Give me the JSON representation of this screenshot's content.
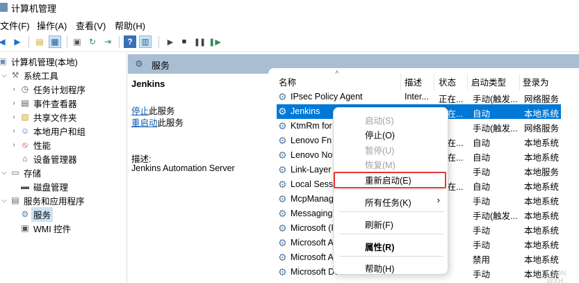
{
  "window": {
    "title": "计算机管理"
  },
  "menu": [
    "文件(F)",
    "操作(A)",
    "查看(V)",
    "帮助(H)"
  ],
  "tree": {
    "root": "计算机管理(本地)",
    "system_tools": "系统工具",
    "task_scheduler": "任务计划程序",
    "event_viewer": "事件查看器",
    "shared_folders": "共享文件夹",
    "local_users": "本地用户和组",
    "performance": "性能",
    "device_manager": "设备管理器",
    "storage": "存储",
    "disk_management": "磁盘管理",
    "services_apps": "服务和应用程序",
    "services": "服务",
    "wmi": "WMI 控件"
  },
  "pane": {
    "title": "服务"
  },
  "description": {
    "service_name": "Jenkins",
    "stop_link": "停止",
    "stop_suffix": "此服务",
    "restart_link": "重启动",
    "restart_suffix": "此服务",
    "desc_label": "描述:",
    "desc_text": "Jenkins Automation Server"
  },
  "columns": {
    "name": "名称",
    "desc": "描述",
    "status": "状态",
    "startup": "启动类型",
    "logon": "登录为"
  },
  "rows": [
    {
      "name": "IPsec Policy Agent",
      "desc": "Inter...",
      "status": "正在...",
      "startup": "手动(触发...",
      "logon": "网络服务"
    },
    {
      "name": "Jenkins",
      "desc": "",
      "status": "正在...",
      "startup": "自动",
      "logon": "本地系统",
      "selected": true
    },
    {
      "name": "KtmRm for",
      "desc": "",
      "status": "",
      "startup": "手动(触发...",
      "logon": "网络服务"
    },
    {
      "name": "Lenovo Fn a",
      "desc": "",
      "status": "正在...",
      "startup": "自动",
      "logon": "本地系统"
    },
    {
      "name": "Lenovo Not",
      "desc": "",
      "status": "正在...",
      "startup": "自动",
      "logon": "本地系统"
    },
    {
      "name": "Link-Layer T",
      "desc": "",
      "status": "",
      "startup": "手动",
      "logon": "本地服务"
    },
    {
      "name": "Local Sessio",
      "desc": "",
      "status": "正在...",
      "startup": "自动",
      "logon": "本地系统"
    },
    {
      "name": "McpManage",
      "desc": "",
      "status": "",
      "startup": "手动",
      "logon": "本地系统"
    },
    {
      "name": "MessagingS",
      "desc": "",
      "status": "",
      "startup": "手动(触发...",
      "logon": "本地系统"
    },
    {
      "name": "Microsoft (F",
      "desc": "",
      "status": "",
      "startup": "手动",
      "logon": "本地系统"
    },
    {
      "name": "Microsoft A",
      "desc": "",
      "status": "",
      "startup": "手动",
      "logon": "本地系统"
    },
    {
      "name": "Microsoft A",
      "desc": "",
      "status": "",
      "startup": "禁用",
      "logon": "本地系统"
    },
    {
      "name": "Microsoft Defender",
      "desc": "",
      "status": "",
      "startup": "手动",
      "logon": "本地系统"
    }
  ],
  "context_menu": {
    "start": "启动(S)",
    "stop": "停止(O)",
    "pause": "暂停(U)",
    "resume": "恢复(M)",
    "restart": "重新启动(E)",
    "all_tasks": "所有任务(K)",
    "refresh": "刷新(F)",
    "properties": "属性(R)",
    "help": "帮助(H)"
  },
  "watermark": "CSDN @XH"
}
